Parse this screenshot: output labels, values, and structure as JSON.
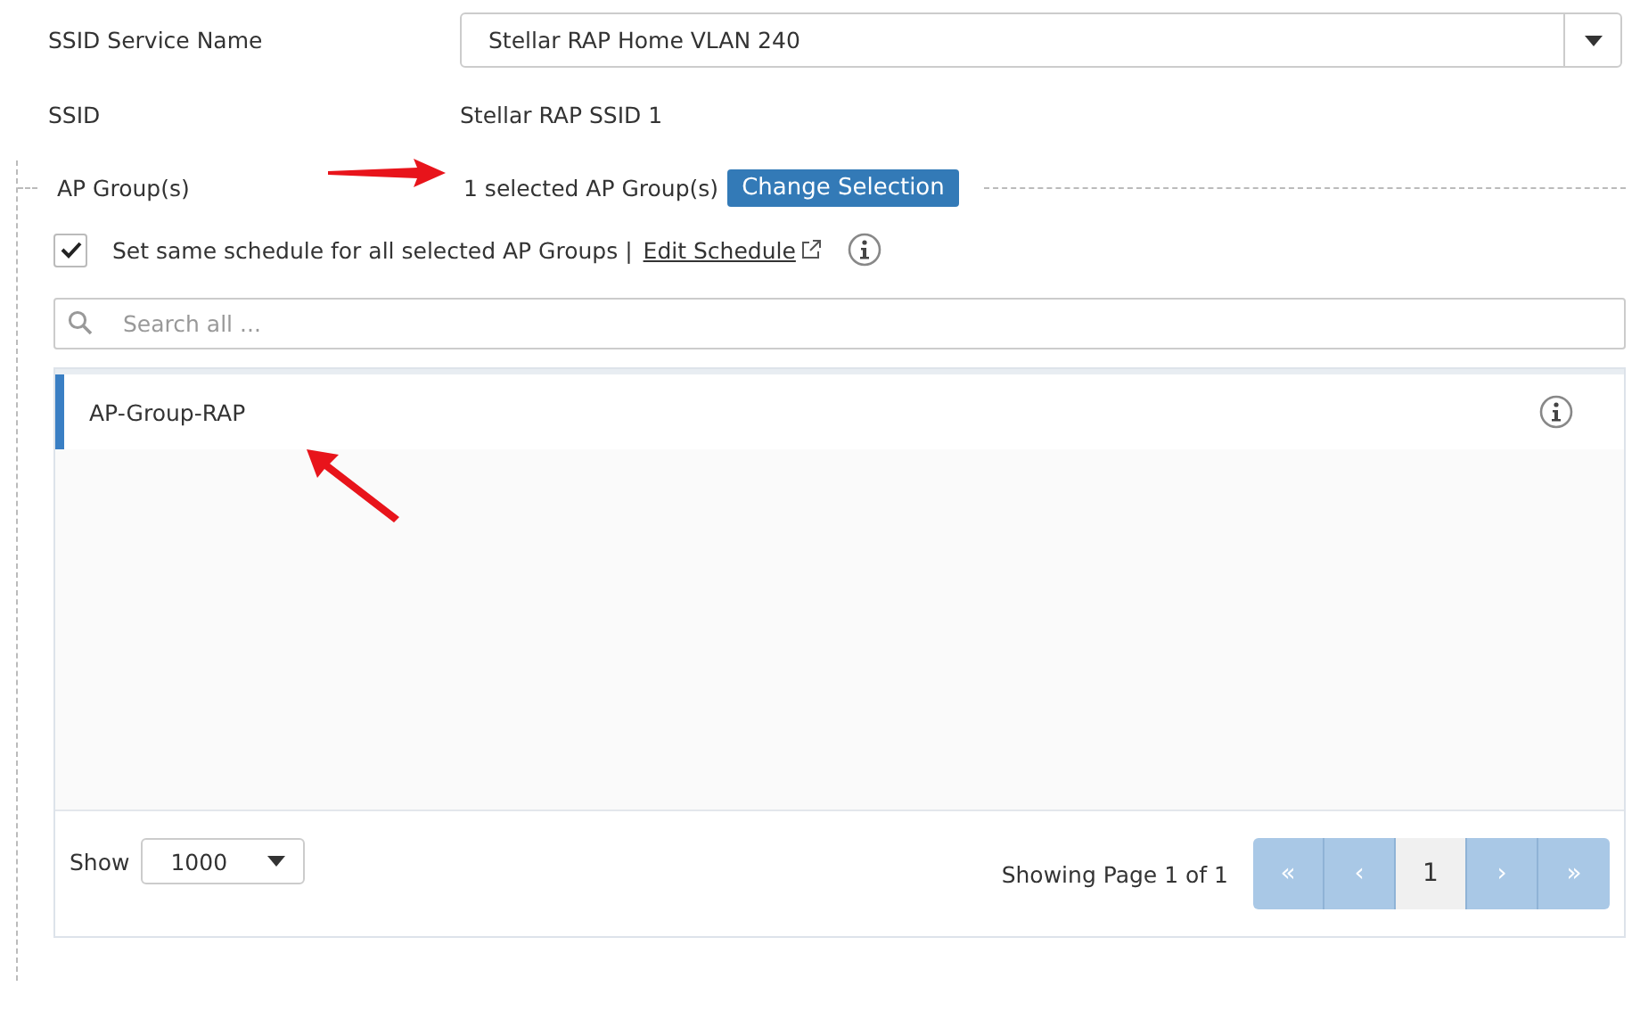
{
  "fields": [
    {
      "label": "SSID Service Name",
      "kind": "select",
      "value": "Stellar RAP Home VLAN 240"
    },
    {
      "label": "SSID",
      "kind": "text",
      "value": "Stellar RAP SSID 1"
    }
  ],
  "ap_groups": {
    "label": "AP Group(s)",
    "summary": "1 selected AP Group(s)",
    "button": "Change Selection",
    "schedule": {
      "checked": true,
      "text": "Set same schedule for all selected AP Groups |",
      "link": "Edit Schedule"
    },
    "search": {
      "placeholder": "Search all ..."
    },
    "items": [
      {
        "name": "AP-Group-RAP",
        "selected": true
      }
    ],
    "footer": {
      "show_label": "Show",
      "page_size": "1000",
      "status": "Showing Page 1 of 1",
      "pager": [
        {
          "label": "«",
          "selected": false
        },
        {
          "label": "‹",
          "selected": false
        },
        {
          "label": "1",
          "selected": true
        },
        {
          "label": "›",
          "selected": false
        },
        {
          "label": "»",
          "selected": false
        }
      ]
    }
  }
}
